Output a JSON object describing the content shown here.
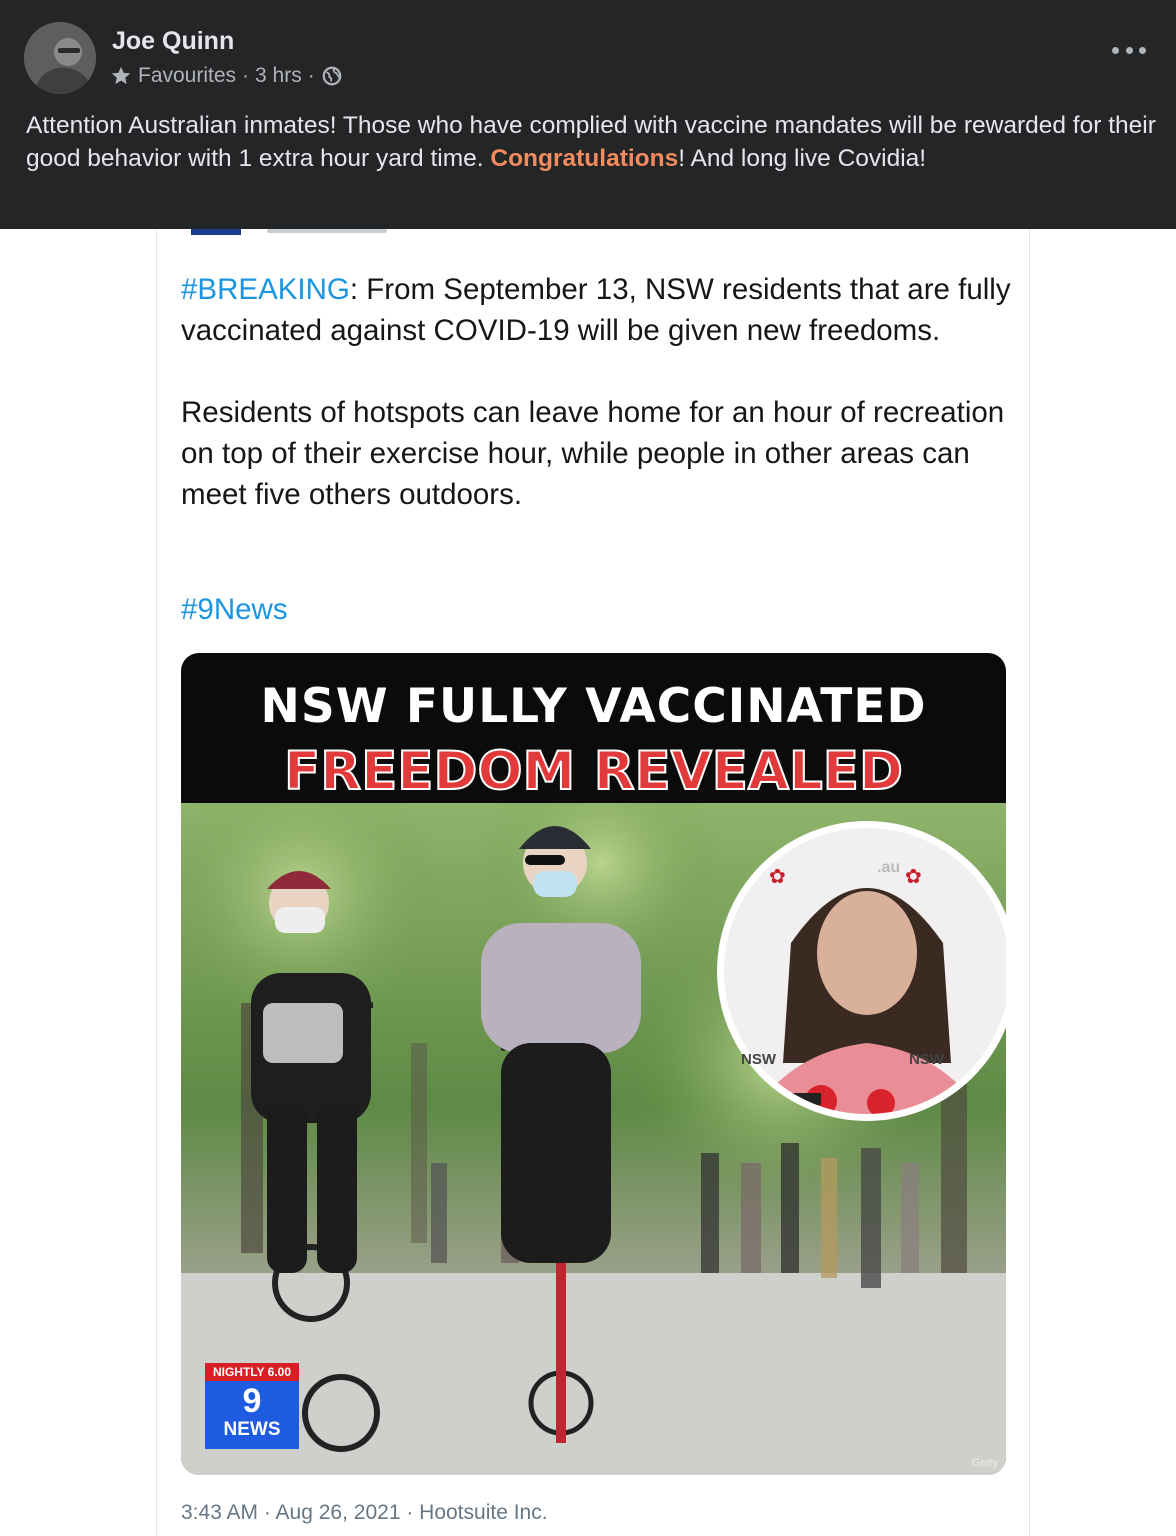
{
  "post": {
    "author": "Joe Quinn",
    "audience": "Favourites",
    "separator": "·",
    "time": "3 hrs",
    "icons": {
      "star": "star-icon",
      "globe": "globe-icon",
      "more": "more-options-icon"
    },
    "text_before": "Attention Australian inmates! Those who have complied with vaccine mandates will be rewarded for their good behavior with 1 extra hour yard time. ",
    "text_highlight": "Congratulations",
    "text_after": "! And long live Covidia!",
    "highlight_color": "#f28b5e",
    "background_color": "#242526"
  },
  "tweet": {
    "hashtag_breaking": "#BREAKING",
    "para1_rest": ": From September 13, NSW residents that are fully vaccinated against COVID-19 will be given new freedoms.",
    "para2": "Residents of hotspots can leave home for an hour of recreation on top of their exercise hour, while people in other areas can meet five others outdoors.",
    "hashtag_news": "#9News",
    "link_color": "#1b95e0",
    "footer": "3:43 AM · Aug 26, 2021 · Hootsuite Inc."
  },
  "image": {
    "title": "NSW FULLY VACCINATED",
    "subtitle": "FREEDOM REVEALED",
    "subtitle_color": "#e23a3a",
    "inset_sign_left": "NSW",
    "inset_sign_right": "NSW",
    "inset_sign_top": ".au",
    "badge_top": "NIGHTLY 6.00",
    "badge_number": "9",
    "badge_word": "NEWS",
    "credit": "Getty"
  }
}
